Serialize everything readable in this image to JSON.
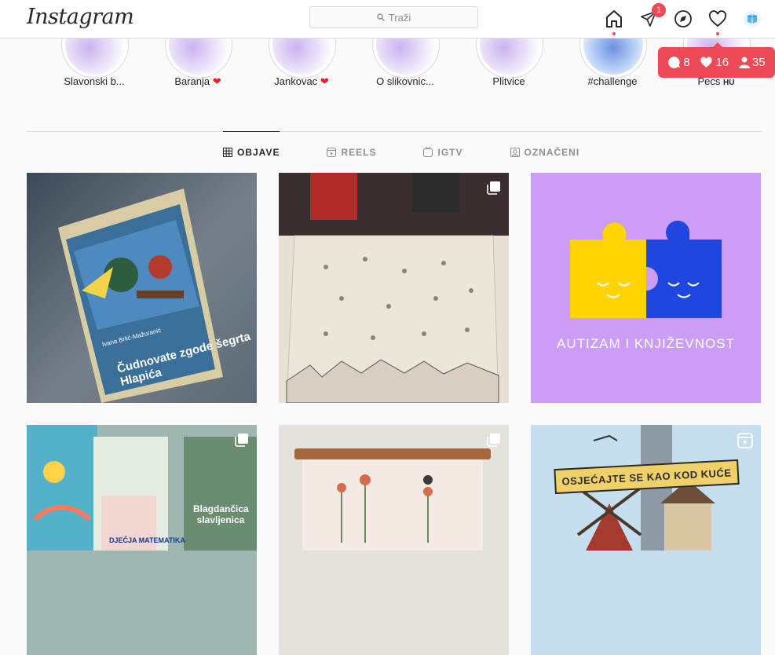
{
  "app": {
    "logo": "Instagram"
  },
  "search": {
    "placeholder": "Traži"
  },
  "nav": {
    "direct_badge": "1"
  },
  "notifications": {
    "comments": "8",
    "likes": "16",
    "followers": "35"
  },
  "highlights": [
    {
      "label": "Slavonski b...",
      "heart": false
    },
    {
      "label": "Baranja",
      "heart": true
    },
    {
      "label": "Jankovac",
      "heart": true
    },
    {
      "label": "O slikovnic...",
      "heart": false
    },
    {
      "label": "Plitvice",
      "heart": false
    },
    {
      "label": "#challenge",
      "heart": false
    },
    {
      "label": "Pecs",
      "suffix": "HU",
      "heart": false
    }
  ],
  "tabs": [
    {
      "label": "OBJAVE",
      "active": true
    },
    {
      "label": "REELS",
      "active": false
    },
    {
      "label": "IGTV",
      "active": false
    },
    {
      "label": "OZNAČENI",
      "active": false
    }
  ],
  "posts": [
    {
      "text": "Čudnovate zgode šegrta Hlapića",
      "author": "Ivana Brlić-Mažuranić",
      "multi": false
    },
    {
      "multi": true
    },
    {
      "text": "AUTIZAM I KNJIŽEVNOST",
      "multi": false
    },
    {
      "text": "Blagdančica slavljenica",
      "extra": "DJEČJA MATEMATIKA",
      "multi": true
    },
    {
      "multi": true
    },
    {
      "text": "OSJEĆAJTE SE KAO KOD KUĆE",
      "reel": true
    }
  ],
  "colors": {
    "accent": "#ed4956",
    "purple": "#cc9df7",
    "yellow": "#ffd400",
    "blue": "#1f47e0"
  }
}
